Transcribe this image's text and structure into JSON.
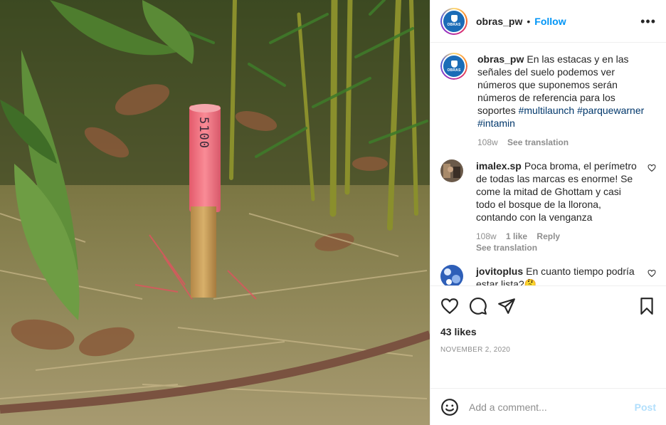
{
  "post": {
    "username": "obras_pw",
    "follow_label": "Follow",
    "separator": "•",
    "more_label": "•••",
    "avatar_text": "OBRAS",
    "stake_number": "5100"
  },
  "caption": {
    "username": "obras_pw",
    "text": "En las estacas y en las señales del suelo podemos ver números que suponemos serán números de referencia para los soportes ",
    "hashtags": [
      "#multilaunch",
      "#parquewarner",
      "#intamin"
    ],
    "age": "108w",
    "see_translation": "See translation"
  },
  "comments": [
    {
      "username": "imalex.sp",
      "text": "Poca broma, el perímetro de todas las marcas es enorme! Se come la mitad de Ghottam y casi todo el bosque de la llorona, contando con la venganza",
      "age": "108w",
      "likes": "1 like",
      "reply": "Reply",
      "see_translation": "See translation"
    },
    {
      "username": "jovitoplus",
      "text": "En cuanto tiempo podría estar lista?🤔"
    }
  ],
  "actions": {
    "likes": "43 likes",
    "date": "NOVEMBER 2, 2020",
    "comment_placeholder": "Add a comment...",
    "post_label": "Post"
  },
  "icons": [
    "heart-icon",
    "comment-icon",
    "share-icon",
    "bookmark-icon",
    "emoji-icon",
    "more-icon"
  ],
  "colors": {
    "link": "#0095f6",
    "hashtag": "#00376b",
    "muted": "#8e8e8e",
    "post_disabled": "#b2dffc",
    "stake": "#f26a7b"
  }
}
